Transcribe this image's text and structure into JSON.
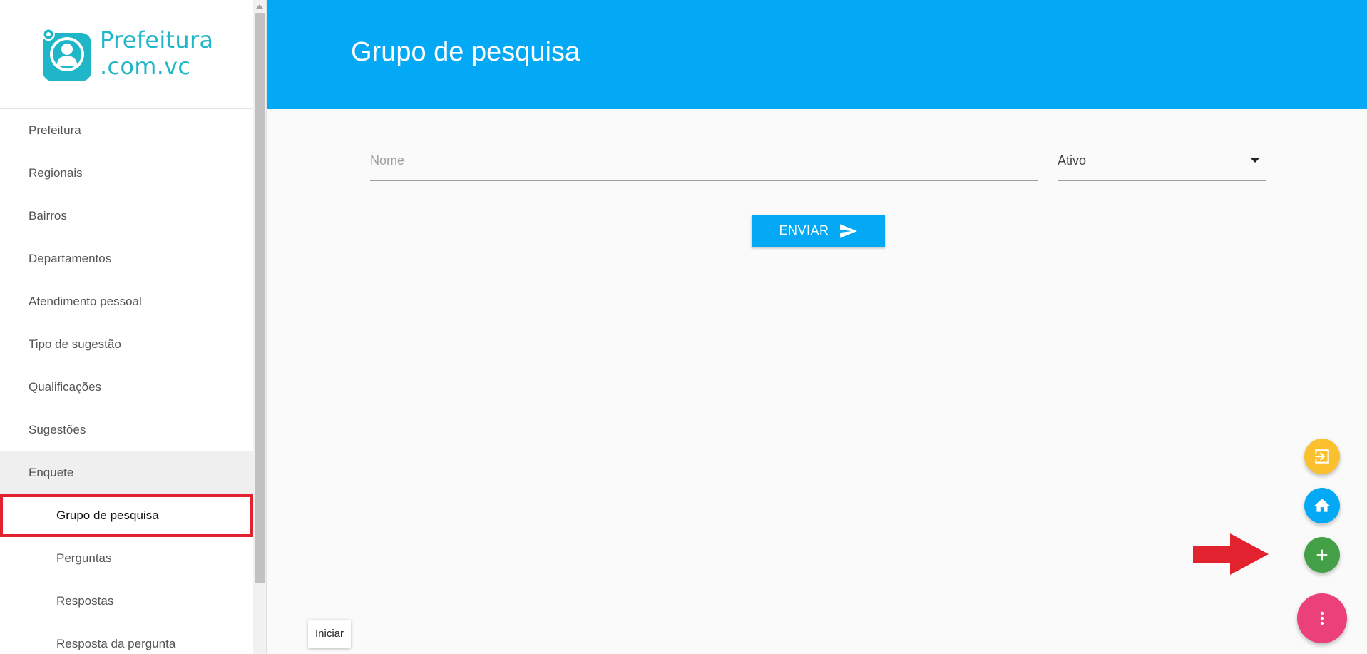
{
  "brand": {
    "line1": "Prefeitura",
    "line2": ".com.vc",
    "color": "#1fb6c8"
  },
  "header": {
    "title": "Grupo de pesquisa",
    "color": "#03a9f4"
  },
  "sidebar": {
    "items": [
      {
        "label": "Prefeitura"
      },
      {
        "label": "Regionais"
      },
      {
        "label": "Bairros"
      },
      {
        "label": "Departamentos"
      },
      {
        "label": "Atendimento pessoal"
      },
      {
        "label": "Tipo de sugestão"
      },
      {
        "label": "Qualificações"
      },
      {
        "label": "Sugestões"
      },
      {
        "label": "Enquete"
      }
    ],
    "subitems": [
      {
        "label": "Grupo de pesquisa",
        "selected": true
      },
      {
        "label": "Perguntas"
      },
      {
        "label": "Respostas"
      },
      {
        "label": "Resposta da pergunta"
      }
    ]
  },
  "form": {
    "name_placeholder": "Nome",
    "name_value": "",
    "status_value": "Ativo",
    "send_label": "ENVIAR"
  },
  "fabs": [
    {
      "name": "exit-icon",
      "color": "#fbc02d"
    },
    {
      "name": "home-icon",
      "color": "#03a9f4"
    },
    {
      "name": "plus-icon",
      "color": "#43a047"
    },
    {
      "name": "more-vertical-icon",
      "color": "#ec407a"
    }
  ],
  "tooltip": {
    "text": "Iniciar"
  },
  "highlight_color": "#e2232f"
}
